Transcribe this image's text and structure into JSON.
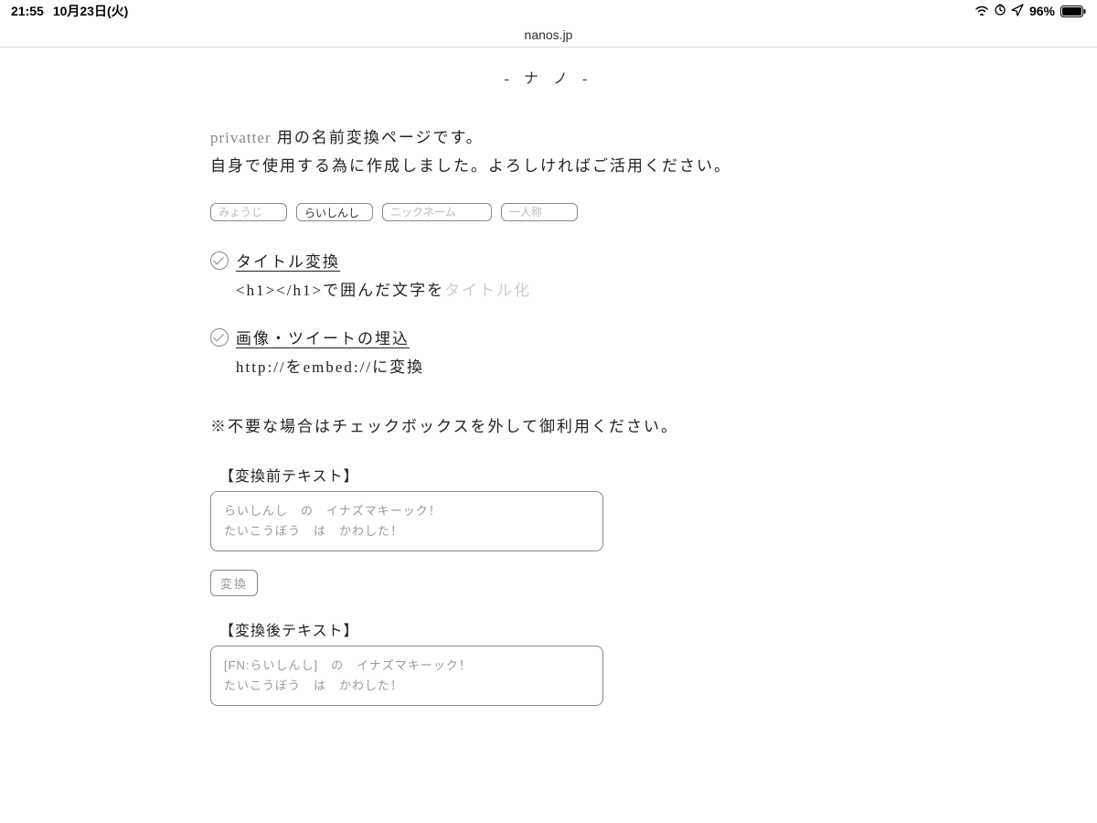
{
  "status": {
    "time": "21:55",
    "date": "10月23日(火)",
    "battery_pct": "96%"
  },
  "browser": {
    "url": "nanos.jp"
  },
  "page": {
    "title": "-  ナ ノ  -",
    "intro_prefix": "privatter",
    "intro_suffix": " 用の名前変換ページです。",
    "intro_line2": "自身で使用する為に作成しました。よろしければご活用ください。",
    "inputs": {
      "myouji": {
        "placeholder": "みょうじ",
        "value": ""
      },
      "name": {
        "placeholder": "",
        "value": "らいしんし"
      },
      "nickname": {
        "placeholder": "ニックネーム",
        "value": ""
      },
      "firstperson": {
        "placeholder": "一人称",
        "value": ""
      }
    },
    "check1": {
      "label": "タイトル変換",
      "desc_main": "<h1></h1>で囲んだ文字を",
      "desc_faded": "タイトル化"
    },
    "check2": {
      "label": "画像・ツイートの埋込",
      "desc": "http://をembed://に変換"
    },
    "note": "※不要な場合はチェックボックスを外して御利用ください。",
    "before": {
      "label": "【変換前テキスト】",
      "text": "らいしんし　の　イナズマキーック！\nたいこうぼう　は　かわした！"
    },
    "convert_btn": "変換",
    "after": {
      "label": "【変換後テキスト】",
      "text": "[FN:らいしんし]　の　イナズマキーック！\nたいこうぼう　は　かわした！"
    }
  }
}
